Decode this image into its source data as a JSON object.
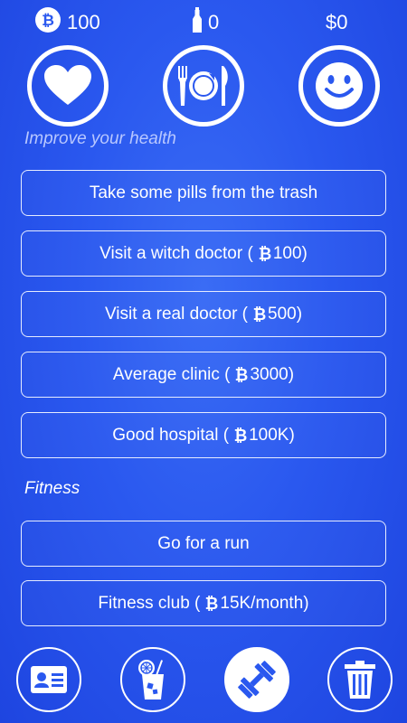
{
  "stats": {
    "coins": "100",
    "bottles": "0",
    "money": "$0"
  },
  "icons": {
    "coin": "bitcoin-icon",
    "bottle": "bottle-icon",
    "health": "heart-icon",
    "food": "plate-icon",
    "mood": "smiley-icon"
  },
  "sections": {
    "health": "Improve your health",
    "fitness": "Fitness"
  },
  "options": {
    "pills": "Take some pills from the trash",
    "witch": {
      "pre": "Visit a witch doctor (",
      "price": "100)"
    },
    "real": {
      "pre": "Visit a real doctor (",
      "price": "500)"
    },
    "clinic": {
      "pre": "Average clinic (",
      "price": "3000)"
    },
    "hospital": {
      "pre": "Good hospital (",
      "price": "100K)"
    },
    "run": "Go for a run",
    "club": {
      "pre": "Fitness club (",
      "price": "15K/month)"
    }
  },
  "nav": {
    "items": [
      "id-card-icon",
      "drink-icon",
      "dumbbell-icon",
      "trash-icon"
    ],
    "active": "dumbbell-icon"
  },
  "colors": {
    "background": "#2a58ef",
    "foreground": "#ffffff",
    "section_dim": "#b8c7ff"
  }
}
